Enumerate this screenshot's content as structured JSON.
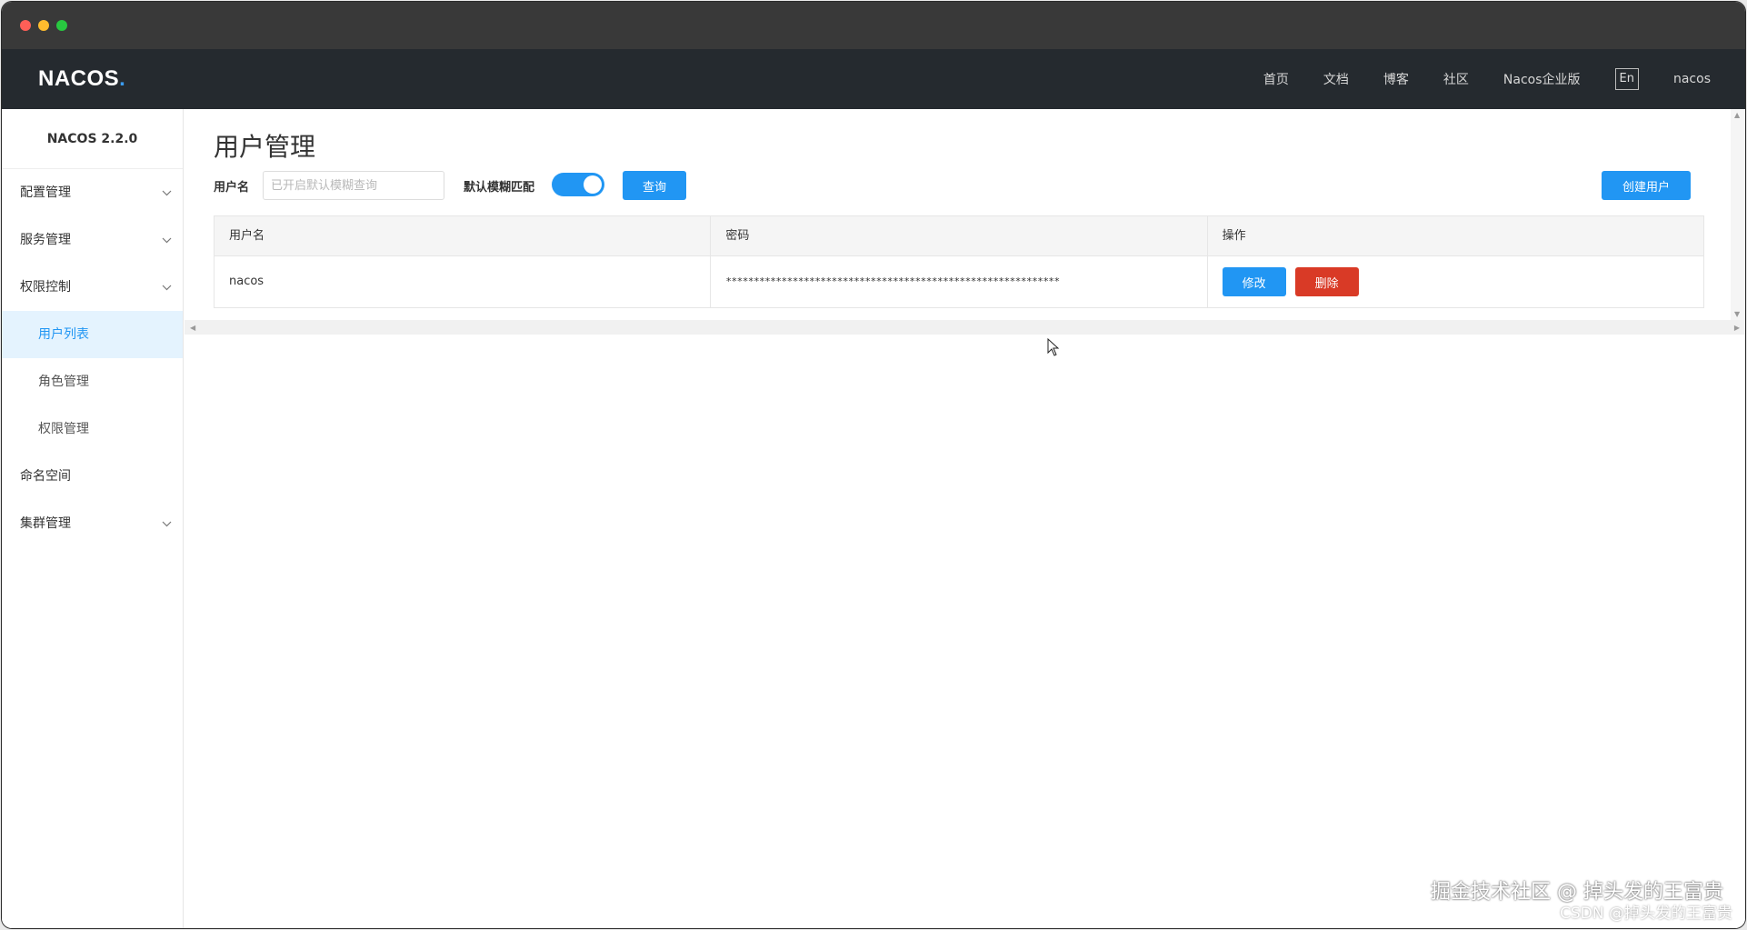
{
  "app": {
    "logo": "NACOS",
    "logo_dot": "."
  },
  "topnav": {
    "links": [
      "首页",
      "文档",
      "博客",
      "社区",
      "Nacos企业版"
    ],
    "lang": "En",
    "user": "nacos"
  },
  "sidebar": {
    "version": "NACOS 2.2.0",
    "items": [
      {
        "label": "配置管理",
        "expandable": true
      },
      {
        "label": "服务管理",
        "expandable": true
      },
      {
        "label": "权限控制",
        "expandable": true
      },
      {
        "label": "用户列表",
        "active": true
      },
      {
        "label": "角色管理"
      },
      {
        "label": "权限管理"
      },
      {
        "label": "命名空间"
      },
      {
        "label": "集群管理",
        "expandable": true
      }
    ]
  },
  "main": {
    "title": "用户管理",
    "filter": {
      "username_label": "用户名",
      "username_placeholder": "已开启默认模糊查询",
      "fuzzy_label": "默认模糊匹配",
      "fuzzy_on": true,
      "query_label": "查询",
      "create_label": "创建用户"
    },
    "table": {
      "headers": [
        "用户名",
        "密码",
        "操作"
      ],
      "rows": [
        {
          "username": "nacos",
          "password": "************************************************************",
          "edit_label": "修改",
          "delete_label": "删除"
        }
      ]
    }
  },
  "watermark": {
    "line1": "掘金技术社区 @ 掉头发的王富贵",
    "line2": "CSDN @掉头发的王富贵"
  },
  "colors": {
    "accent": "#2196f3",
    "danger": "#d93a26",
    "nav_bg": "#252a2f",
    "titlebar_bg": "#393939"
  }
}
